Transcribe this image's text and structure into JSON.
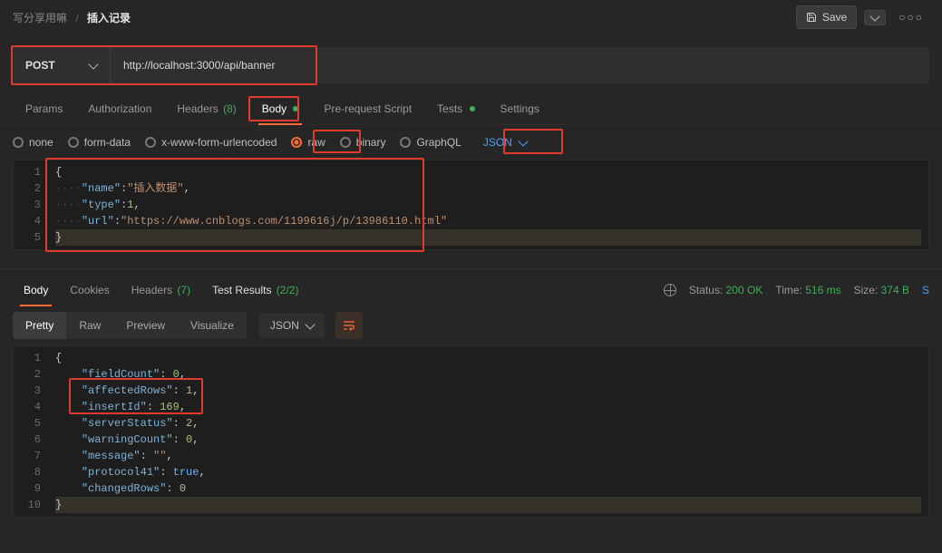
{
  "breadcrumb": {
    "parent": "写分享用嘛",
    "sep": "/",
    "current": "插入记录"
  },
  "actions": {
    "save": "Save"
  },
  "request": {
    "method": "POST",
    "url": "http://localhost:3000/api/banner"
  },
  "tabs": {
    "params": "Params",
    "authorization": "Authorization",
    "headers": "Headers",
    "headers_count": "(8)",
    "body": "Body",
    "prerequest": "Pre-request Script",
    "tests": "Tests",
    "settings": "Settings"
  },
  "body_types": {
    "none": "none",
    "form_data": "form-data",
    "x_www": "x-www-form-urlencoded",
    "raw": "raw",
    "binary": "binary",
    "graphql": "GraphQL",
    "json": "JSON"
  },
  "request_body_lines": {
    "l1": {
      "open": "{"
    },
    "l2": {
      "dots": "····",
      "key": "\"name\"",
      "colon": ":",
      "val": "\"插入数据\"",
      "comma": ","
    },
    "l3": {
      "dots": "····",
      "key": "\"type\"",
      "colon": ":",
      "val": "1",
      "comma": ","
    },
    "l4": {
      "dots": "····",
      "key": "\"url\"",
      "colon": ":",
      "val": "\"https://www.cnblogs.com/1199616j/p/13986110.html\""
    },
    "l5": {
      "close": "}"
    }
  },
  "response": {
    "tabs": {
      "body": "Body",
      "cookies": "Cookies",
      "headers": "Headers",
      "headers_count": "(7)",
      "test_results": "Test Results",
      "tr_count": "(2/2)"
    },
    "meta": {
      "status_label": "Status:",
      "status_value": "200 OK",
      "time_label": "Time:",
      "time_value": "516 ms",
      "size_label": "Size:",
      "size_value": "374 B",
      "save_short": "S"
    },
    "view": {
      "pretty": "Pretty",
      "raw": "Raw",
      "preview": "Preview",
      "visualize": "Visualize",
      "format": "JSON"
    },
    "body_lines": {
      "l1": {
        "open": "{"
      },
      "l2": {
        "key": "\"fieldCount\"",
        "val": "0"
      },
      "l3": {
        "key": "\"affectedRows\"",
        "val": "1"
      },
      "l4": {
        "key": "\"insertId\"",
        "val": "169"
      },
      "l5": {
        "key": "\"serverStatus\"",
        "val": "2"
      },
      "l6": {
        "key": "\"warningCount\"",
        "val": "0"
      },
      "l7": {
        "key": "\"message\"",
        "val": "\"\""
      },
      "l8": {
        "key": "\"protocol41\"",
        "val": "true"
      },
      "l9": {
        "key": "\"changedRows\"",
        "val": "0"
      },
      "l10": {
        "close": "}"
      }
    }
  }
}
